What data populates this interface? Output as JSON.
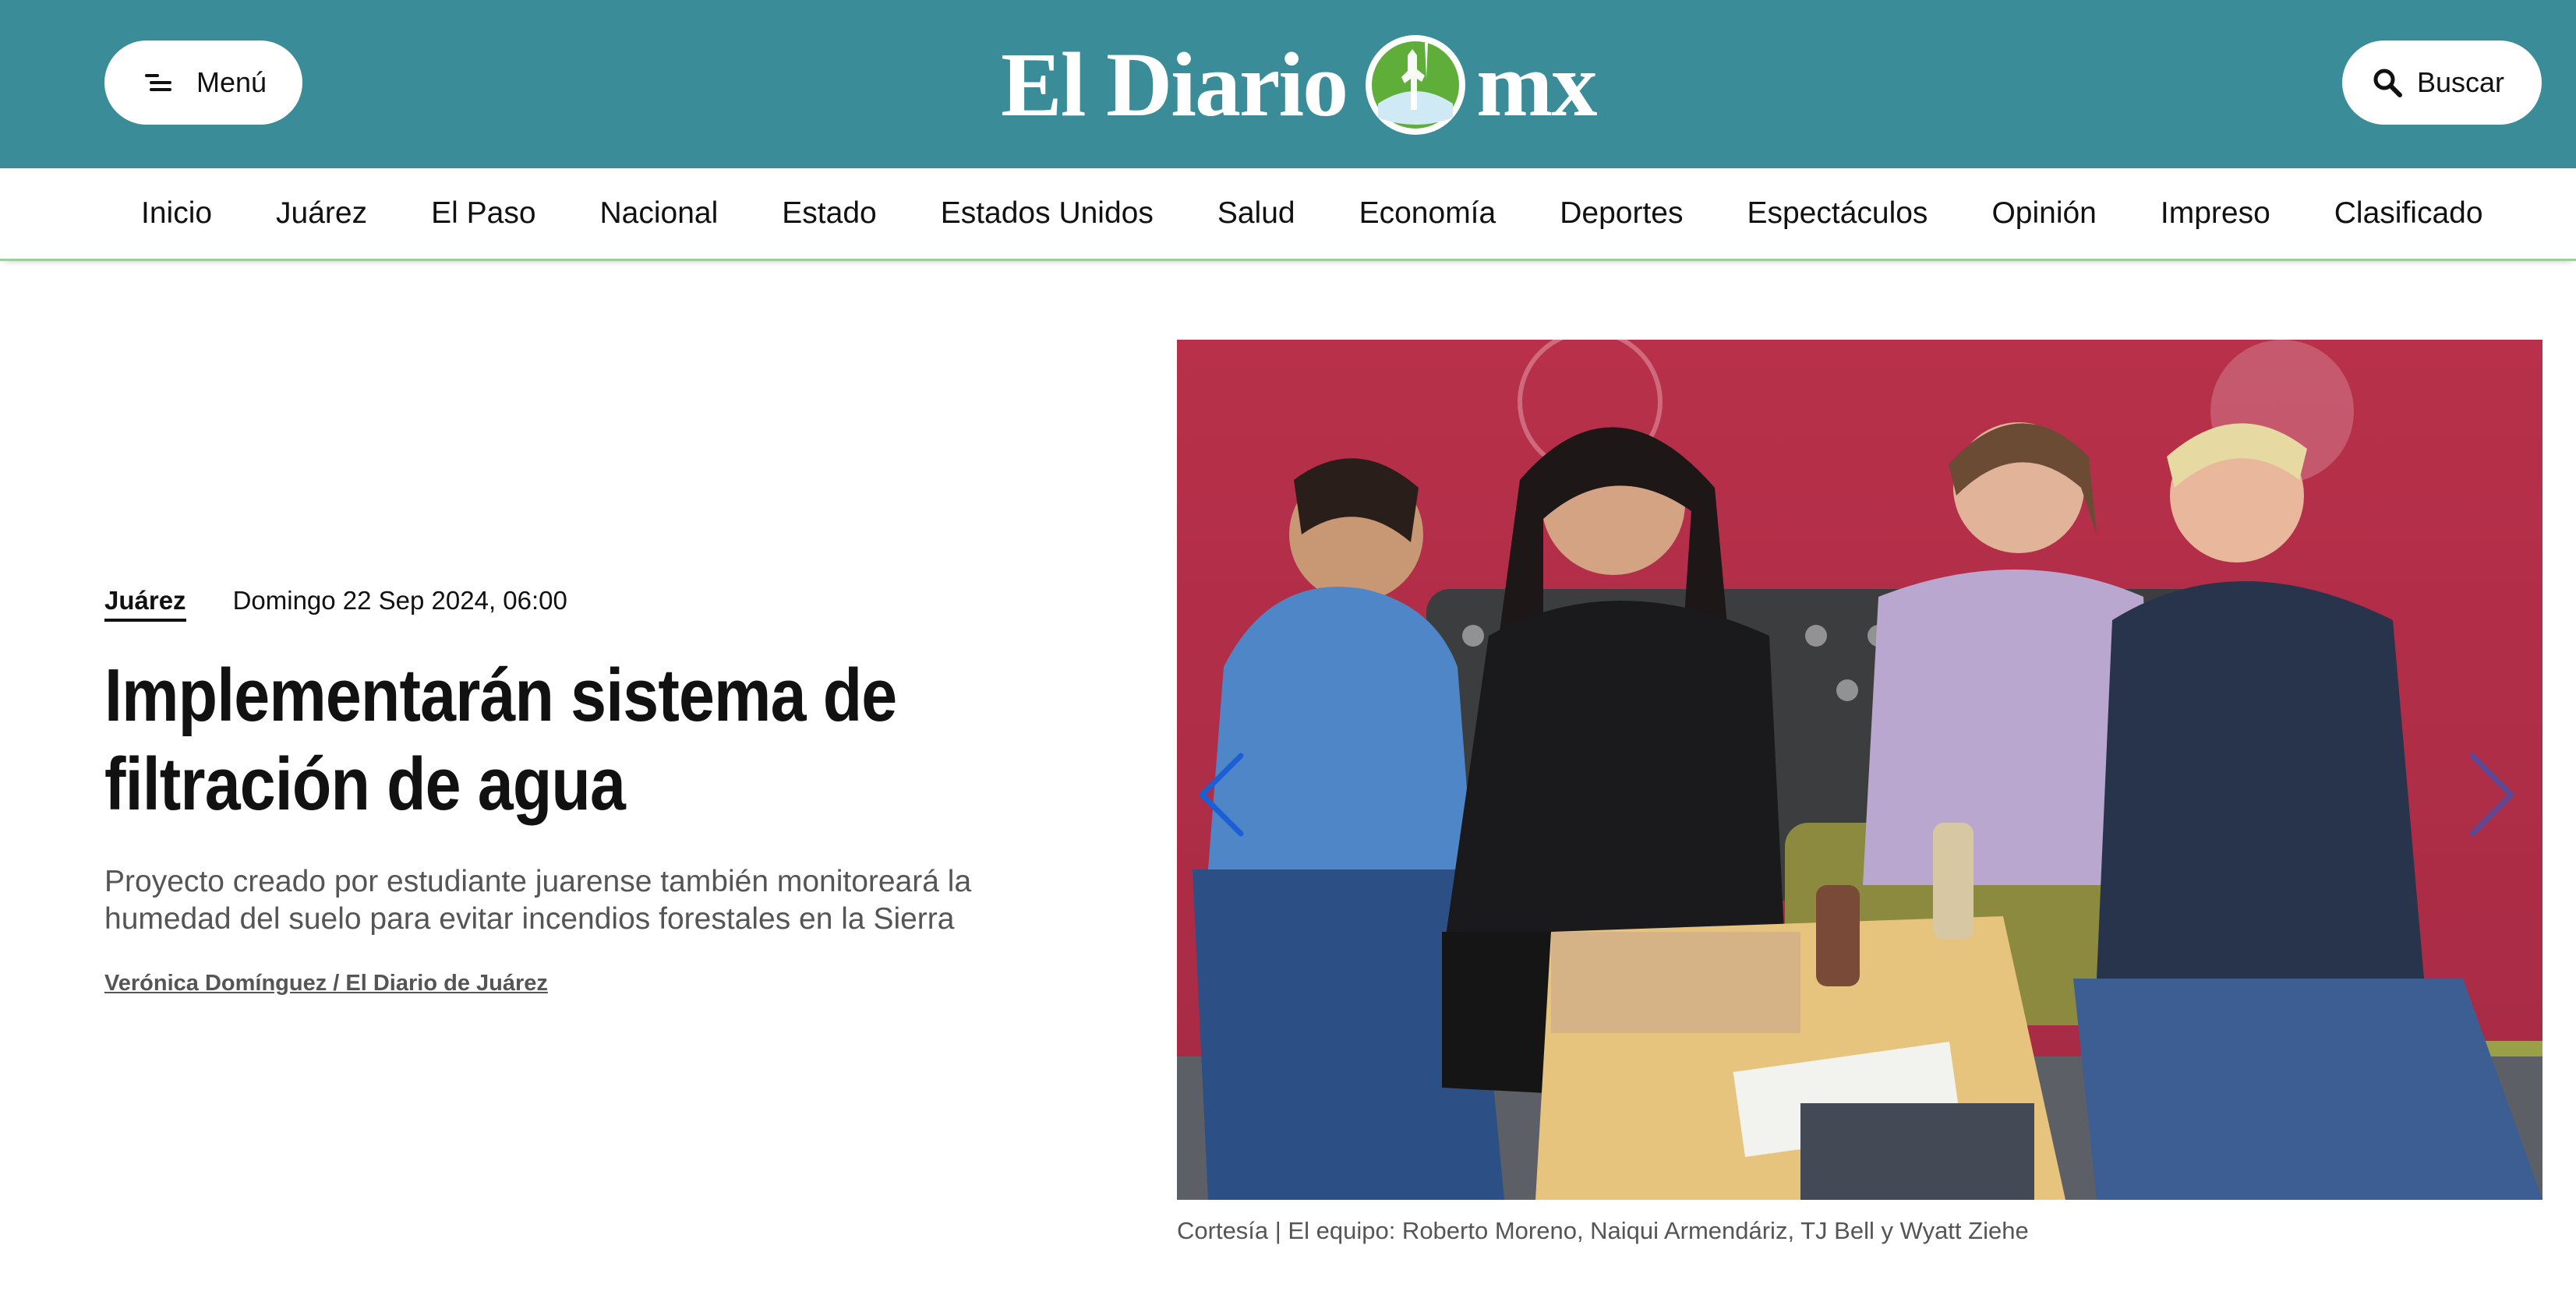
{
  "header": {
    "menu_label": "Menú",
    "search_label": "Buscar",
    "logo_left": "El Diario",
    "logo_right": "mx",
    "bg_color": "#3a8d98"
  },
  "nav": {
    "items": [
      "Inicio",
      "Juárez",
      "El Paso",
      "Nacional",
      "Estado",
      "Estados Unidos",
      "Salud",
      "Economía",
      "Deportes",
      "Espectáculos",
      "Opinión",
      "Impreso",
      "Clasificado"
    ]
  },
  "article": {
    "section": "Juárez",
    "date": "Domingo 22 Sep 2024, 06:00",
    "headline": "Implementarán sistema de filtración de agua",
    "dek": "Proyecto creado por estudiante juarense también monitoreará la humedad del suelo para evitar incendios forestales en la Sierra",
    "byline": "Verónica Domínguez / El Diario de Juárez",
    "caption": "Cortesía | El equipo: Roberto Moreno, Naiqui Armendáriz, TJ Bell y Wyatt Ziehe"
  },
  "icons": {
    "menu": "menu-icon",
    "search": "search-icon",
    "carousel_prev": "chevron-left-icon",
    "carousel_next": "chevron-right-icon",
    "logo": "logo-emblem-icon"
  },
  "colors": {
    "accent": "#3a8d98",
    "nav_border": "#9ccf9a",
    "chevron": "#1a5fd6"
  }
}
